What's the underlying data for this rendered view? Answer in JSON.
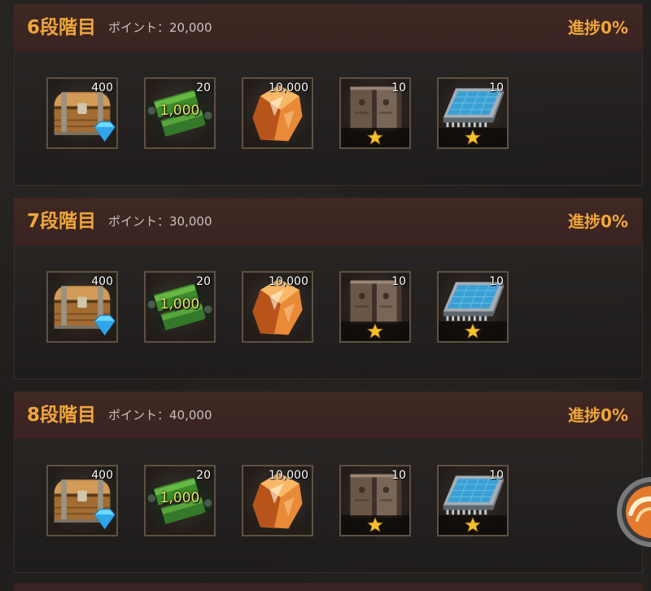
{
  "stages": [
    {
      "title": "6段階目",
      "points": "ポイント：20,000",
      "progress": "進捗0%",
      "rewards": [
        {
          "icon": "treasure-chest",
          "count": "400"
        },
        {
          "icon": "green-canister",
          "count": "20",
          "overlay": "1,000"
        },
        {
          "icon": "orange-crystal",
          "count": "10,000"
        },
        {
          "icon": "stone-tablet",
          "count": "10",
          "star": "star"
        },
        {
          "icon": "blue-chip",
          "count": "10",
          "star": "star"
        }
      ]
    },
    {
      "title": "7段階目",
      "points": "ポイント：30,000",
      "progress": "進捗0%",
      "rewards": [
        {
          "icon": "treasure-chest",
          "count": "400"
        },
        {
          "icon": "green-canister",
          "count": "20",
          "overlay": "1,000"
        },
        {
          "icon": "orange-crystal",
          "count": "10,000"
        },
        {
          "icon": "stone-tablet",
          "count": "10",
          "star": "star"
        },
        {
          "icon": "blue-chip",
          "count": "10",
          "star": "star"
        }
      ]
    },
    {
      "title": "8段階目",
      "points": "ポイント：40,000",
      "progress": "進捗0%",
      "rewards": [
        {
          "icon": "treasure-chest",
          "count": "400"
        },
        {
          "icon": "green-canister",
          "count": "20",
          "overlay": "1,000"
        },
        {
          "icon": "orange-crystal",
          "count": "10,000"
        },
        {
          "icon": "stone-tablet",
          "count": "10",
          "star": "star"
        },
        {
          "icon": "blue-chip",
          "count": "10",
          "star": "star"
        }
      ]
    }
  ],
  "floating_button": {
    "icon": "orange-swirl"
  },
  "colors": {
    "title": "#f0a63a",
    "header_bg": "#3a2320",
    "overlay": "#e8e46a",
    "count": "#ffffff",
    "background": "#1e1c1b"
  }
}
